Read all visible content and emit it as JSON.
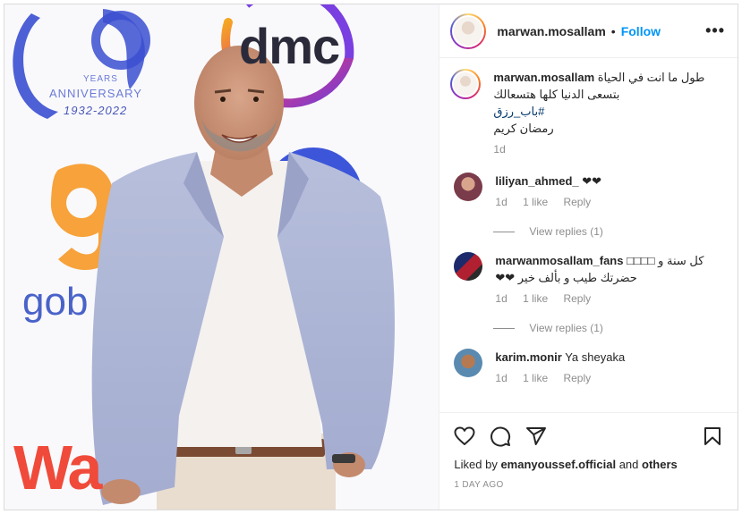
{
  "post": {
    "username": "marwan.mosallam",
    "follow_label": "Follow",
    "dot": "•",
    "more_label": "•••"
  },
  "photo": {
    "dmc": "dmc",
    "years": "YEARS",
    "anniversary": "ANNIVERSARY",
    "year_range": "1932-2022",
    "gob": "gob",
    "wa": "Wa"
  },
  "caption": {
    "username": "marwan.mosallam",
    "line1": "طول ما انت في الحياة",
    "line2": "بتسعى الدنيا كلها هتسعالك",
    "hashtag": "#باب_رزق",
    "line4": "رمضان كريم",
    "age": "1d"
  },
  "comments": [
    {
      "username": "liliyan_ahmed_",
      "text": "❤❤",
      "age": "1d",
      "likes": "1 like",
      "reply": "Reply",
      "view_replies": "View replies (1)"
    },
    {
      "username": "marwanmosallam_fans",
      "text": "□□□□ كل سنة و",
      "text2": "حضرتك طيب و بألف خير ❤❤",
      "age": "1d",
      "likes": "1 like",
      "reply": "Reply",
      "view_replies": "View replies (1)"
    },
    {
      "username": "karim.monir",
      "text": "Ya sheyaka",
      "age": "1d",
      "likes": "1 like",
      "reply": "Reply"
    }
  ],
  "footer": {
    "liked_by_prefix": "Liked by",
    "liked_by_user": "emanyoussef.official",
    "and": "and",
    "others": "others",
    "time": "1 DAY AGO"
  },
  "colors": {
    "accent": "#0095f6",
    "hashtag": "#00376b",
    "muted": "#8e8e8e",
    "dmc_ring": "#7a3fe0"
  },
  "icons": [
    "like-heart-icon",
    "comment-icon",
    "share-icon",
    "save-icon",
    "more-options-icon",
    "comment-like-heart-icon"
  ]
}
